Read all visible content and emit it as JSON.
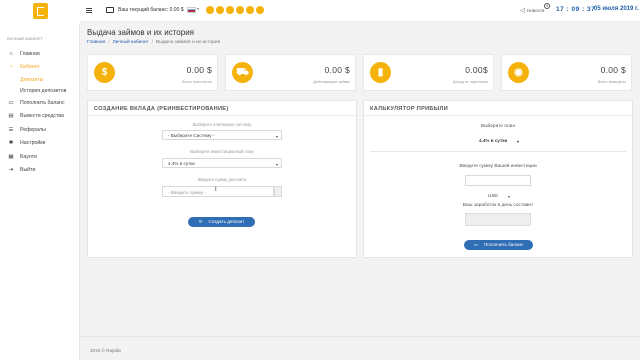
{
  "sidebar": {
    "caption": "ЛИЧНЫЙ КАБИНЕТ",
    "items": [
      {
        "label": "Главная",
        "icon": "home-icon",
        "glyph": "⌂"
      },
      {
        "label": "Кабинет",
        "icon": "cabinet-icon",
        "glyph": "◔"
      },
      {
        "label": "Депозиты",
        "sub": true
      },
      {
        "label": "История депозитов",
        "sub": true
      },
      {
        "label": "Пополнить баланс",
        "icon": "wallet-icon",
        "glyph": "▭"
      },
      {
        "label": "Вывести средства",
        "icon": "withdraw-icon",
        "glyph": "▤"
      },
      {
        "label": "Рефералы",
        "icon": "users-icon",
        "glyph": "☰"
      },
      {
        "label": "Настройки",
        "icon": "gear-icon",
        "glyph": "✱"
      },
      {
        "label": "Баунти",
        "icon": "bounty-icon",
        "glyph": "▦"
      },
      {
        "label": "Выйти",
        "icon": "logout-icon",
        "glyph": "⇥"
      }
    ]
  },
  "topbar": {
    "balance_label": "Ваш текущий баланс: 0.00 $",
    "news_label": "Новости",
    "notif_count": "0",
    "time": "17 : 09 : 37",
    "date": "05 июля 2019 г."
  },
  "page": {
    "title": "Выдача займов и их история",
    "breadcrumbs": [
      "Главная",
      "Личный кабинет",
      "Выдача займов и их история"
    ]
  },
  "stats": [
    {
      "value": "0.00 $",
      "label": "Всего пополнено",
      "icon": "dollar-icon",
      "glyph": "$"
    },
    {
      "value": "0.00 $",
      "label": "Действующие займы",
      "icon": "cart-icon",
      "glyph": "⛟"
    },
    {
      "value": "0.00$",
      "label": "Доход от партнеров",
      "icon": "bar-chart-icon",
      "glyph": "▮"
    },
    {
      "value": "0.00 $",
      "label": "Всего выведено",
      "icon": "eye-icon",
      "glyph": "◉"
    }
  ],
  "deposit_form": {
    "title": "СОЗДАНИЕ ВКЛАДА (РЕИНВЕСТИРОВАНИЕ)",
    "system_label": "Выберите платежную систему",
    "system_value": "- Выберите Систему -",
    "plan_label": "Выберите инвестиционный план",
    "plan_value": "4.4% в сутки",
    "amount_label": "Введите сумму депозита",
    "amount_placeholder": "- Введите сумму -",
    "submit_label": "Создать депозит"
  },
  "calculator": {
    "title": "КАЛЬКУЛЯТОР ПРИБЫЛИ",
    "plan_label": "Выберите план",
    "plan_value": "4.4% в сутки",
    "amount_label": "Введите сумму Вашей инвестиции",
    "currency_value": "USD",
    "daily_label": "Ваш заработок в день составит",
    "button_label": "Пополнить баланс"
  },
  "footer": {
    "text": "2019 © Rapida"
  },
  "colors": {
    "accent": "#f5b20a",
    "primary": "#2f6db5",
    "clock": "#1f5fa8"
  }
}
